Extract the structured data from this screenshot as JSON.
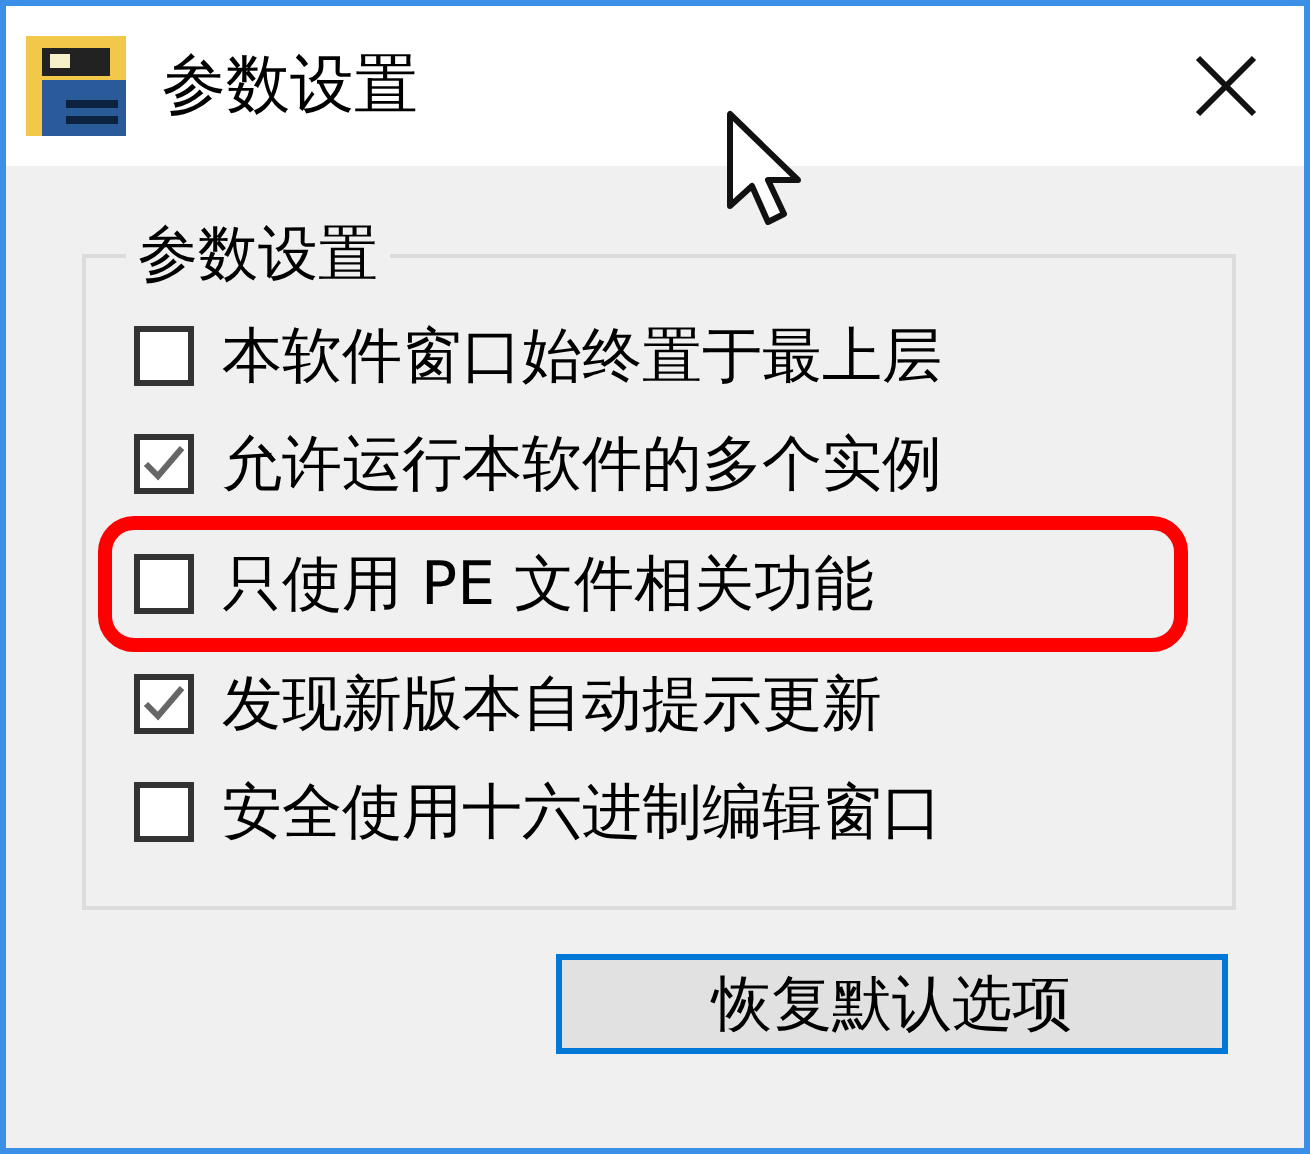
{
  "window": {
    "title": "参数设置"
  },
  "group": {
    "title": "参数设置"
  },
  "options": [
    {
      "label": "本软件窗口始终置于最上层",
      "checked": false,
      "highlighted": false
    },
    {
      "label": "允许运行本软件的多个实例",
      "checked": true,
      "highlighted": false
    },
    {
      "label": "只使用 PE 文件相关功能",
      "checked": false,
      "highlighted": true
    },
    {
      "label": "发现新版本自动提示更新",
      "checked": true,
      "highlighted": false
    },
    {
      "label": "安全使用十六进制编辑窗口",
      "checked": false,
      "highlighted": false
    }
  ],
  "buttons": [
    "恢复默认选项"
  ]
}
